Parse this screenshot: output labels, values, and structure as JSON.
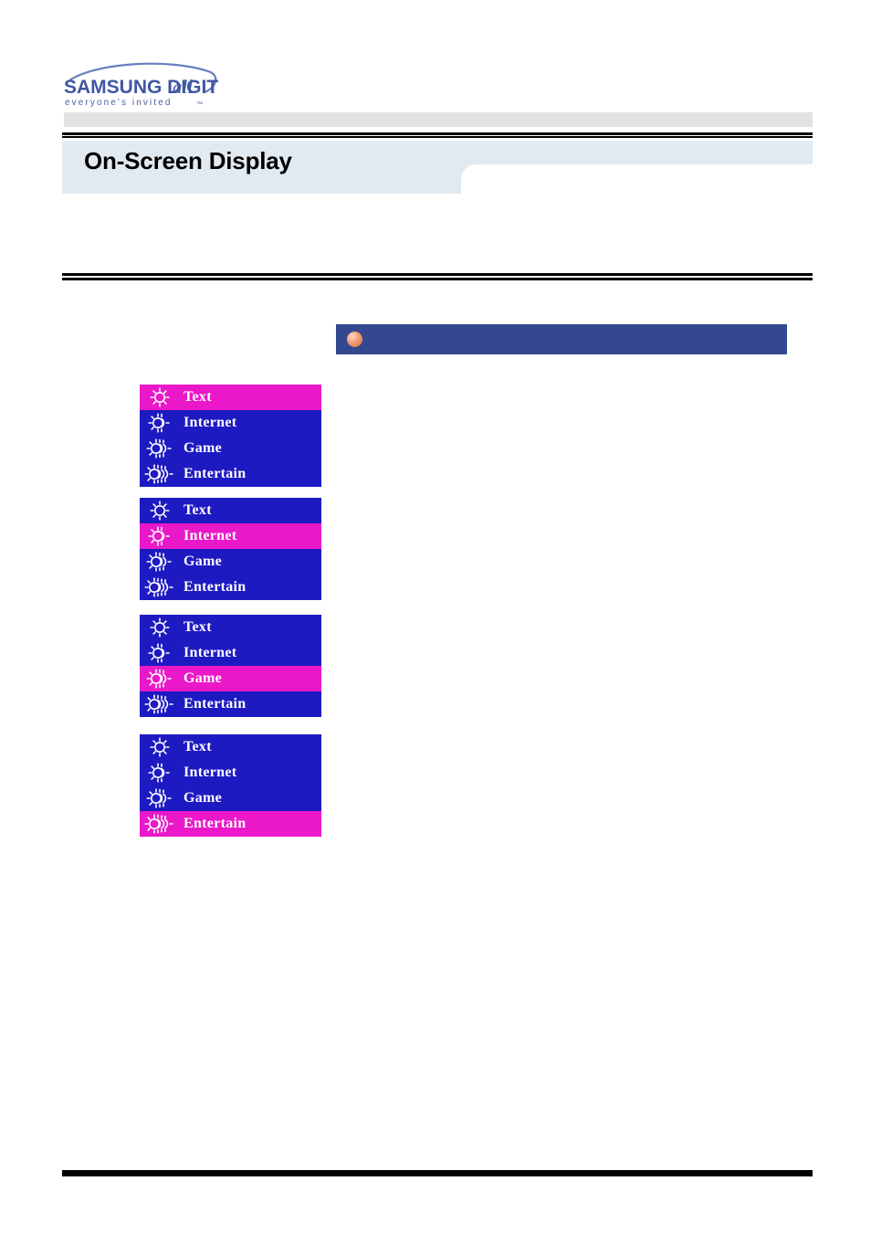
{
  "brand": {
    "name": "SAMSUNG DIGITall",
    "wordmark_main": "SAMSUNG DIGIT",
    "wordmark_italic": "all",
    "tagline": "everyone's invited",
    "trademark": "™",
    "logo_color": "#4a5fa5"
  },
  "header": {
    "title": "On-Screen Display",
    "title_band_color": "#e2eaf1",
    "gray_bar_color": "#e2e2e2"
  },
  "section": {
    "bullet_icon": "orange-sphere-bullet-icon",
    "bullet_color": "#e07a42",
    "header_label": "",
    "bar_color": "#33488f"
  },
  "osd": {
    "colors": {
      "background": "#1e1ac2",
      "selected": "#ea18c8",
      "text": "#ffffff"
    },
    "menu_items": [
      {
        "label": "Text",
        "icon": "brightness-level-1-icon",
        "level": 1
      },
      {
        "label": "Internet",
        "icon": "brightness-level-2-icon",
        "level": 2
      },
      {
        "label": "Game",
        "icon": "brightness-level-3-icon",
        "level": 3
      },
      {
        "label": "Entertain",
        "icon": "brightness-level-4-icon",
        "level": 4
      }
    ],
    "panels": [
      {
        "name": "panel-text-selected",
        "selected_index": 0,
        "selected_label": "Text"
      },
      {
        "name": "panel-internet-selected",
        "selected_index": 1,
        "selected_label": "Internet"
      },
      {
        "name": "panel-game-selected",
        "selected_index": 2,
        "selected_label": "Game"
      },
      {
        "name": "panel-entertain-selected",
        "selected_index": 3,
        "selected_label": "Entertain"
      }
    ]
  }
}
